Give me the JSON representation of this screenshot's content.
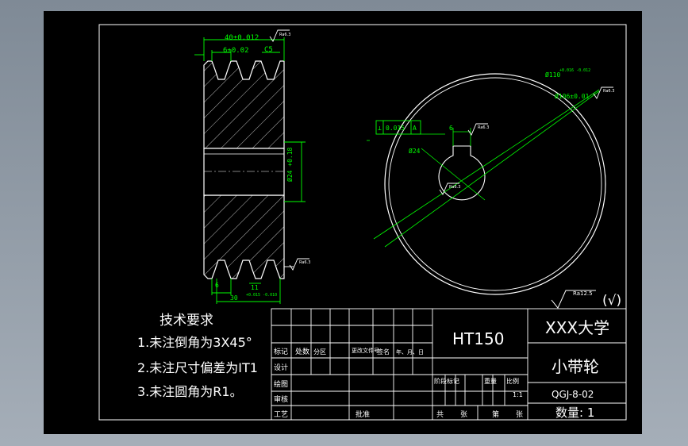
{
  "colors": {
    "background_window": "#8e98a3",
    "sheet": "#000000",
    "outline": "#ffffff",
    "dimension": "#00ff00",
    "hatch": "#cccccc",
    "annotation": "#00ffff"
  },
  "dims": {
    "width_total": "40±0.012",
    "groove_pitch": "6±0.02",
    "chamfer": "C5",
    "rough_top": "Ra6.3",
    "bore_dia": "Ø24",
    "bore_vert": "Ø24 +0.18",
    "bottom_groove": "6",
    "bottom_pitch": "11",
    "bottom_total": "30",
    "bottom_tol": "+0.015 -0.010",
    "rough_right": "Ra6.3",
    "outer_dia": "Ø110",
    "outer_tol": "+0.016 -0.012",
    "pitch_dia": "Ø106±0.01",
    "rough_od": "Ra6.3",
    "keyway": "6",
    "rough_key": "Ra6.3",
    "bore_label": "Ø24",
    "rough_bore": "Ra6.3",
    "tolerance_frame": [
      "⟂",
      "0.015",
      "A"
    ],
    "rough_general": "Ra12.5",
    "check": "(√)"
  },
  "notes": {
    "title": "技术要求",
    "items": [
      "1.未注倒角为3X45°",
      "2.未注尺寸偏差为IT1",
      "3.未注圆角为R1。"
    ]
  },
  "title_block": {
    "material": "HT150",
    "university": "XXX大学",
    "part_name": "小带轮",
    "drawing_no": "QGJ-8-02",
    "quantity": "数量: 1",
    "scale": "1:1",
    "header_labels": [
      "标记",
      "处数",
      "分区",
      "更改文件号",
      "签名",
      "年、月、日"
    ],
    "role_labels": [
      "设计",
      "绘图",
      "审核",
      "工艺"
    ],
    "stage_labels": [
      "阶段标记",
      "重量",
      "比例"
    ],
    "approval": "批准",
    "sheets_total": "共",
    "sheets_unit": "张",
    "sheet_no": "第",
    "sheet_unit2": "张"
  }
}
